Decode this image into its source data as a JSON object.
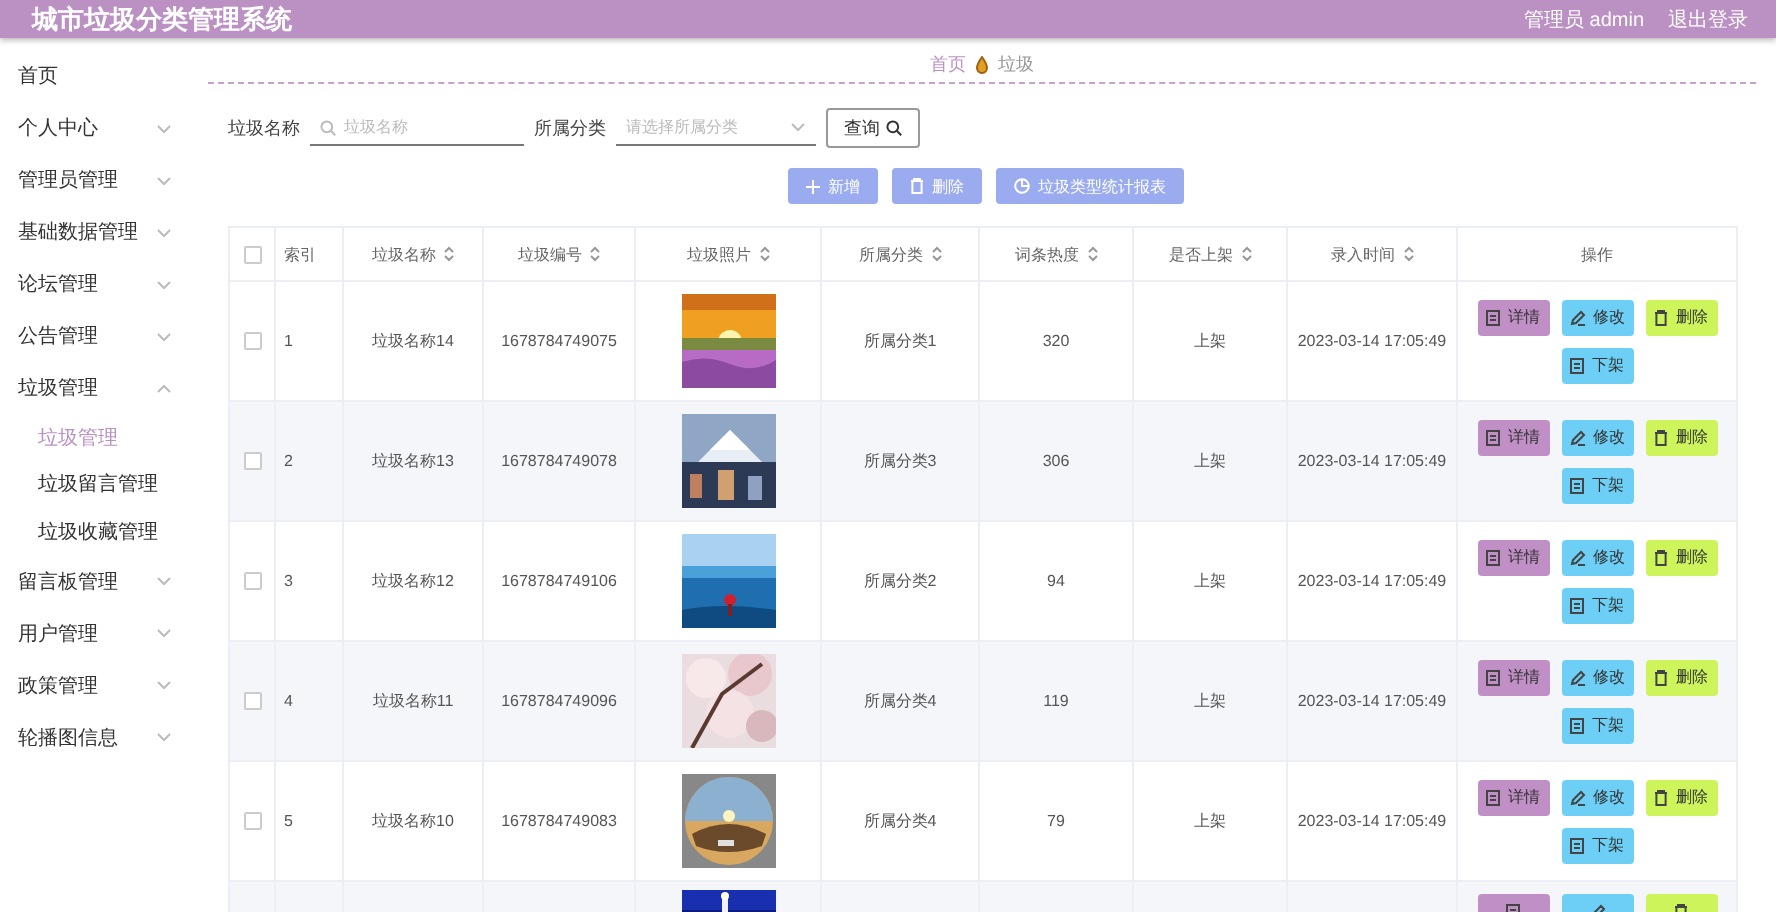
{
  "header": {
    "title": "城市垃圾分类管理系统",
    "user": "管理员 admin",
    "logout": "退出登录"
  },
  "sidebar": {
    "items": [
      {
        "label": "首页",
        "expandable": false
      },
      {
        "label": "个人中心",
        "expandable": true,
        "expanded": false
      },
      {
        "label": "管理员管理",
        "expandable": true,
        "expanded": false
      },
      {
        "label": "基础数据管理",
        "expandable": true,
        "expanded": false
      },
      {
        "label": "论坛管理",
        "expandable": true,
        "expanded": false
      },
      {
        "label": "公告管理",
        "expandable": true,
        "expanded": false
      },
      {
        "label": "垃圾管理",
        "expandable": true,
        "expanded": true,
        "children": [
          {
            "label": "垃圾管理",
            "selected": true
          },
          {
            "label": "垃圾留言管理",
            "selected": false
          },
          {
            "label": "垃圾收藏管理",
            "selected": false
          }
        ]
      },
      {
        "label": "留言板管理",
        "expandable": true,
        "expanded": false
      },
      {
        "label": "用户管理",
        "expandable": true,
        "expanded": false
      },
      {
        "label": "政策管理",
        "expandable": true,
        "expanded": false
      },
      {
        "label": "轮播图信息",
        "expandable": true,
        "expanded": false
      }
    ]
  },
  "breadcrumb": [
    "首页",
    "垃圾"
  ],
  "search": {
    "fields": [
      {
        "kind": "text",
        "label": "垃圾名称",
        "placeholder": "垃圾名称"
      },
      {
        "kind": "select",
        "label": "所属分类",
        "placeholder": "请选择所属分类"
      }
    ],
    "button": "查询"
  },
  "actions": [
    {
      "kind": "add",
      "label": "新增"
    },
    {
      "kind": "delete",
      "label": "删除"
    },
    {
      "kind": "report",
      "label": "垃圾类型统计报表"
    }
  ],
  "table": {
    "select_all": {
      "checked": false
    },
    "columns": [
      {
        "label": "索引",
        "sortable": false
      },
      {
        "label": "垃圾名称",
        "sortable": true
      },
      {
        "label": "垃圾编号",
        "sortable": true
      },
      {
        "label": "垃圾照片",
        "sortable": true
      },
      {
        "label": "所属分类",
        "sortable": true
      },
      {
        "label": "词条热度",
        "sortable": true
      },
      {
        "label": "是否上架",
        "sortable": true
      },
      {
        "label": "录入时间",
        "sortable": true
      },
      {
        "label": "操作",
        "sortable": false
      }
    ],
    "rows": [
      {
        "checked": false,
        "cells": [
          "1",
          "垃圾名称14",
          "1678784749075",
          {
            "kind": "picture"
          },
          "所属分类1",
          "320",
          "上架",
          "2023-03-14 17:05:49"
        ],
        "actions": [
          {
            "kind": "detail",
            "label": "详情"
          },
          {
            "kind": "edit",
            "label": "修改"
          },
          {
            "kind": "delete",
            "label": "删除"
          },
          {
            "kind": "unshelve",
            "label": "下架"
          }
        ]
      },
      {
        "checked": false,
        "cells": [
          "2",
          "垃圾名称13",
          "1678784749078",
          {
            "kind": "picture"
          },
          "所属分类3",
          "306",
          "上架",
          "2023-03-14 17:05:49"
        ],
        "actions": [
          {
            "kind": "detail",
            "label": "详情"
          },
          {
            "kind": "edit",
            "label": "修改"
          },
          {
            "kind": "delete",
            "label": "删除"
          },
          {
            "kind": "unshelve",
            "label": "下架"
          }
        ]
      },
      {
        "checked": false,
        "cells": [
          "3",
          "垃圾名称12",
          "1678784749106",
          {
            "kind": "picture"
          },
          "所属分类2",
          "94",
          "上架",
          "2023-03-14 17:05:49"
        ],
        "actions": [
          {
            "kind": "detail",
            "label": "详情"
          },
          {
            "kind": "edit",
            "label": "修改"
          },
          {
            "kind": "delete",
            "label": "删除"
          },
          {
            "kind": "unshelve",
            "label": "下架"
          }
        ]
      },
      {
        "checked": false,
        "cells": [
          "4",
          "垃圾名称11",
          "1678784749096",
          {
            "kind": "picture"
          },
          "所属分类4",
          "119",
          "上架",
          "2023-03-14 17:05:49"
        ],
        "actions": [
          {
            "kind": "detail",
            "label": "详情"
          },
          {
            "kind": "edit",
            "label": "修改"
          },
          {
            "kind": "delete",
            "label": "删除"
          },
          {
            "kind": "unshelve",
            "label": "下架"
          }
        ]
      },
      {
        "checked": false,
        "cells": [
          "5",
          "垃圾名称10",
          "1678784749083",
          {
            "kind": "picture"
          },
          "所属分类4",
          "79",
          "上架",
          "2023-03-14 17:05:49"
        ],
        "actions": [
          {
            "kind": "detail",
            "label": "详情"
          },
          {
            "kind": "edit",
            "label": "修改"
          },
          {
            "kind": "delete",
            "label": "删除"
          },
          {
            "kind": "unshelve",
            "label": "下架"
          }
        ]
      },
      {
        "picture": {
          "kind": "picture"
        },
        "actions": [
          {
            "kind": "detail"
          },
          {
            "kind": "edit"
          },
          {
            "kind": "delete"
          }
        ]
      }
    ]
  }
}
